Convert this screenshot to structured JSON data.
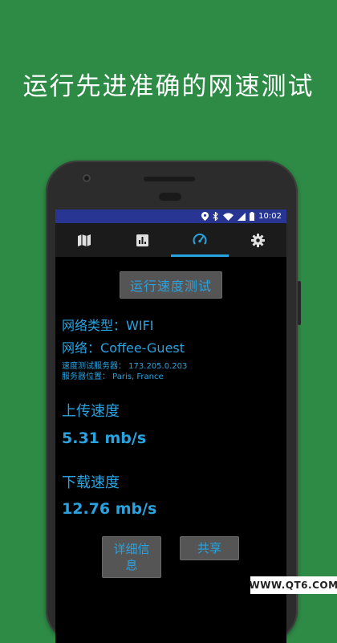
{
  "promo": {
    "title": "运行先进准确的网速测试"
  },
  "statusbar": {
    "time": "10:02"
  },
  "tabs": [
    {
      "icon": "map-icon"
    },
    {
      "icon": "bar-chart-icon"
    },
    {
      "icon": "speedometer-icon",
      "active": true
    },
    {
      "icon": "gear-icon"
    }
  ],
  "main": {
    "run_button": "运行速度测试",
    "network_type": "网络类型：WIFI",
    "network": "网络：Coffee-Guest",
    "test_server": "速度测试服务器：  173.205.0.203",
    "server_location": "服务器位置：  Paris, France",
    "upload_label": "上传速度",
    "upload_value": "5.31 mb/s",
    "download_label": "下载速度",
    "download_value": "12.76 mb/s",
    "details_button": "详细信息",
    "share_button": "共享"
  },
  "colors": {
    "accent": "#29a3e0",
    "background": "#2e8b46",
    "statusbar": "#283593"
  },
  "watermark": "WWW.QT6.COM"
}
